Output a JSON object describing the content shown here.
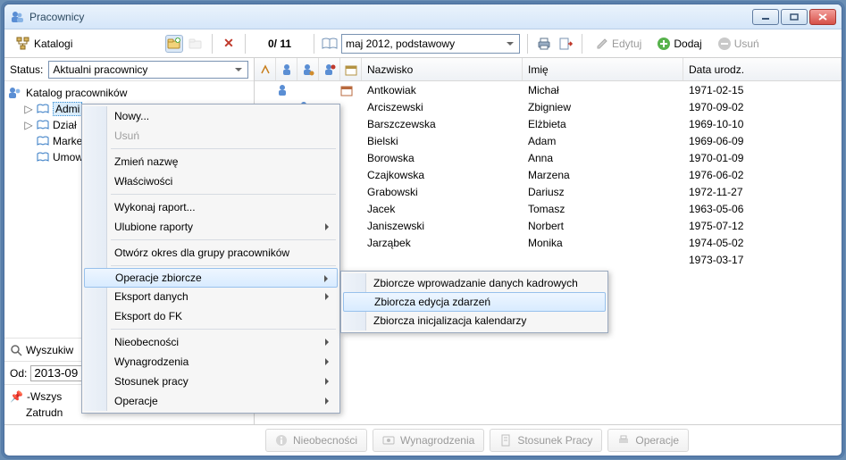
{
  "window": {
    "title": "Pracownicy"
  },
  "toolbar": {
    "catalogs_label": "Katalogi",
    "pager": "0/ 11",
    "period": "maj 2012, podstawowy",
    "edit_label": "Edytuj",
    "add_label": "Dodaj",
    "delete_label": "Usuń"
  },
  "status": {
    "label": "Status:",
    "value": "Aktualni pracownicy"
  },
  "tree": {
    "root": "Katalog pracowników",
    "items": [
      "Admi",
      "Dział",
      "Marke",
      "Umow"
    ]
  },
  "search": {
    "label": "Wyszukiw",
    "placeholder": ""
  },
  "date_filter": {
    "label": "Od:",
    "from": "2013-09"
  },
  "tags": {
    "all": "-Wszys",
    "zatrudnienie": "Zatrudn"
  },
  "grid": {
    "headers": {
      "nazwisko": "Nazwisko",
      "imie": "Imię",
      "data": "Data urodz."
    },
    "rows": [
      {
        "nazwisko": "Antkowiak",
        "imie": "Michał",
        "data": "1971-02-15"
      },
      {
        "nazwisko": "Arciszewski",
        "imie": "Zbigniew",
        "data": "1970-09-02"
      },
      {
        "nazwisko": "Barszczewska",
        "imie": "Elżbieta",
        "data": "1969-10-10"
      },
      {
        "nazwisko": "Bielski",
        "imie": "Adam",
        "data": "1969-06-09"
      },
      {
        "nazwisko": "Borowska",
        "imie": "Anna",
        "data": "1970-01-09"
      },
      {
        "nazwisko": "Czajkowska",
        "imie": "Marzena",
        "data": "1976-06-02"
      },
      {
        "nazwisko": "Grabowski",
        "imie": "Dariusz",
        "data": "1972-11-27"
      },
      {
        "nazwisko": "Jacek",
        "imie": "Tomasz",
        "data": "1963-05-06"
      },
      {
        "nazwisko": "Janiszewski",
        "imie": "Norbert",
        "data": "1975-07-12"
      },
      {
        "nazwisko": "Jarząbek",
        "imie": "Monika",
        "data": "1974-05-02"
      },
      {
        "nazwisko": "",
        "imie": "",
        "data": "1973-03-17"
      }
    ]
  },
  "footer": {
    "absences": "Nieobecności",
    "salaries": "Wynagrodzenia",
    "employment": "Stosunek Pracy",
    "operations": "Operacje"
  },
  "ctx_menu": {
    "new": "Nowy...",
    "delete": "Usuń",
    "rename": "Zmień nazwę",
    "properties": "Właściwości",
    "run_report": "Wykonaj raport...",
    "fav_reports": "Ulubione raporty",
    "open_period": "Otwórz okres dla grupy pracowników",
    "batch_ops": "Operacje zbiorcze",
    "export_data": "Eksport danych",
    "export_fk": "Eksport do FK",
    "absences": "Nieobecności",
    "salaries": "Wynagrodzenia",
    "employment": "Stosunek pracy",
    "operations": "Operacje"
  },
  "sub_menu": {
    "batch_hr": "Zbiorcze wprowadzanie danych kadrowych",
    "batch_events": "Zbiorcza edycja zdarzeń",
    "batch_calendars": "Zbiorcza inicjalizacja kalendarzy"
  }
}
